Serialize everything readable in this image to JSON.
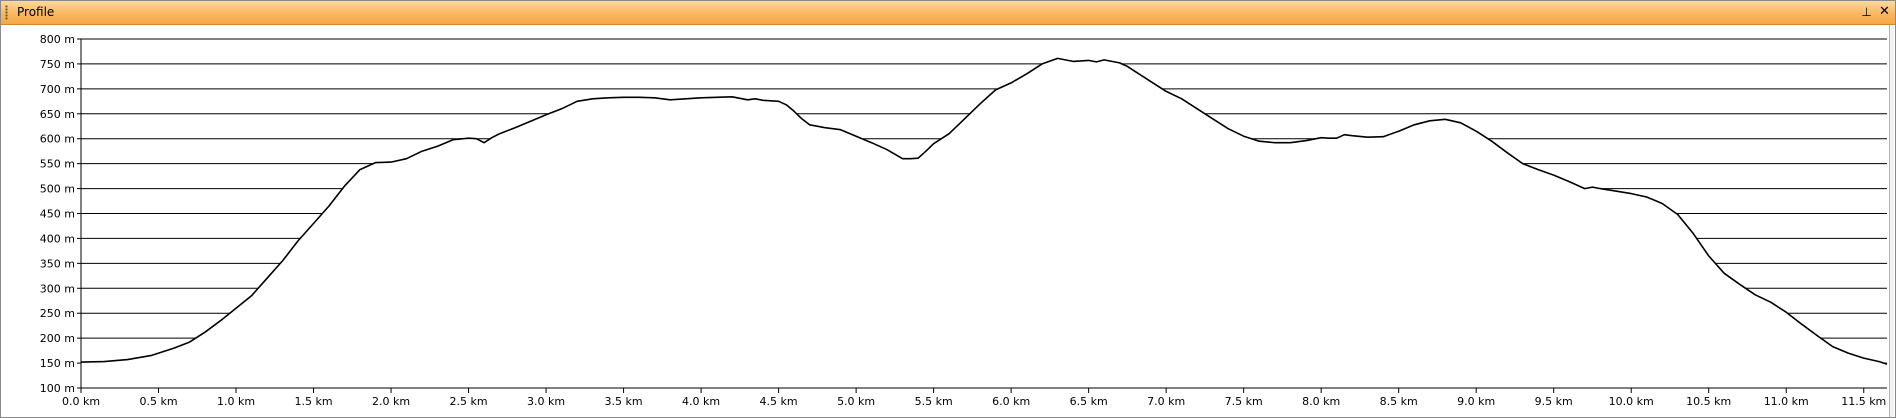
{
  "window": {
    "title": "Profile",
    "pin_icon": "pin-icon",
    "close_icon": "close-icon",
    "pin_glyph": "⊥",
    "close_glyph": "✕",
    "title_bar_color": "#f9b760"
  },
  "chart_data": {
    "type": "area",
    "title": "",
    "xlabel": "",
    "ylabel": "",
    "ylim": [
      100,
      800
    ],
    "xlim": [
      0,
      11.65
    ],
    "grid": "horizontal",
    "line_color": "#000000",
    "y_ticks": [
      {
        "value": 100,
        "label": "100 m"
      },
      {
        "value": 150,
        "label": "150 m"
      },
      {
        "value": 200,
        "label": "200 m"
      },
      {
        "value": 250,
        "label": "250 m"
      },
      {
        "value": 300,
        "label": "300 m"
      },
      {
        "value": 350,
        "label": "350 m"
      },
      {
        "value": 400,
        "label": "400 m"
      },
      {
        "value": 450,
        "label": "450 m"
      },
      {
        "value": 500,
        "label": "500 m"
      },
      {
        "value": 550,
        "label": "550 m"
      },
      {
        "value": 600,
        "label": "600 m"
      },
      {
        "value": 650,
        "label": "650 m"
      },
      {
        "value": 700,
        "label": "700 m"
      },
      {
        "value": 750,
        "label": "750 m"
      },
      {
        "value": 800,
        "label": "800 m"
      }
    ],
    "x_ticks": [
      {
        "value": 0.0,
        "label": "0.0 km"
      },
      {
        "value": 0.5,
        "label": "0.5 km"
      },
      {
        "value": 1.0,
        "label": "1.0 km"
      },
      {
        "value": 1.5,
        "label": "1.5 km"
      },
      {
        "value": 2.0,
        "label": "2.0 km"
      },
      {
        "value": 2.5,
        "label": "2.5 km"
      },
      {
        "value": 3.0,
        "label": "3.0 km"
      },
      {
        "value": 3.5,
        "label": "3.5 km"
      },
      {
        "value": 4.0,
        "label": "4.0 km"
      },
      {
        "value": 4.5,
        "label": "4.5 km"
      },
      {
        "value": 5.0,
        "label": "5.0 km"
      },
      {
        "value": 5.5,
        "label": "5.5 km"
      },
      {
        "value": 6.0,
        "label": "6.0 km"
      },
      {
        "value": 6.5,
        "label": "6.5 km"
      },
      {
        "value": 7.0,
        "label": "7.0 km"
      },
      {
        "value": 7.5,
        "label": "7.5 km"
      },
      {
        "value": 8.0,
        "label": "8.0 km"
      },
      {
        "value": 8.5,
        "label": "8.5 km"
      },
      {
        "value": 9.0,
        "label": "9.0 km"
      },
      {
        "value": 9.5,
        "label": "9.5 km"
      },
      {
        "value": 10.0,
        "label": "10.0 km"
      },
      {
        "value": 10.5,
        "label": "10.5 km"
      },
      {
        "value": 11.0,
        "label": "11.0 km"
      },
      {
        "value": 11.5,
        "label": "11.5 km"
      }
    ],
    "series": [
      {
        "x": [
          0.0,
          0.15,
          0.3,
          0.45,
          0.55,
          0.6,
          0.7,
          0.8,
          0.9,
          1.0,
          1.1,
          1.2,
          1.3,
          1.4,
          1.5,
          1.6,
          1.7,
          1.8,
          1.9,
          2.0,
          2.1,
          2.2,
          2.3,
          2.4,
          2.5,
          2.55,
          2.6,
          2.65,
          2.7,
          2.8,
          2.9,
          3.0,
          3.1,
          3.2,
          3.3,
          3.4,
          3.5,
          3.6,
          3.7,
          3.8,
          3.9,
          4.0,
          4.1,
          4.2,
          4.3,
          4.35,
          4.4,
          4.5,
          4.55,
          4.6,
          4.65,
          4.7,
          4.8,
          4.9,
          5.0,
          5.1,
          5.2,
          5.3,
          5.35,
          5.4,
          5.45,
          5.5,
          5.6,
          5.7,
          5.8,
          5.9,
          6.0,
          6.1,
          6.2,
          6.3,
          6.4,
          6.5,
          6.55,
          6.6,
          6.65,
          6.7,
          6.75,
          6.8,
          6.9,
          7.0,
          7.1,
          7.2,
          7.3,
          7.4,
          7.5,
          7.6,
          7.7,
          7.8,
          7.9,
          8.0,
          8.05,
          8.1,
          8.15,
          8.2,
          8.3,
          8.4,
          8.5,
          8.6,
          8.7,
          8.8,
          8.9,
          9.0,
          9.1,
          9.2,
          9.3,
          9.4,
          9.5,
          9.6,
          9.7,
          9.75,
          9.8,
          9.9,
          10.0,
          10.1,
          10.2,
          10.3,
          10.4,
          10.5,
          10.6,
          10.7,
          10.8,
          10.9,
          11.0,
          11.1,
          11.2,
          11.3,
          11.4,
          11.5,
          11.6,
          11.65
        ],
        "y": [
          152,
          153,
          157,
          165,
          175,
          180,
          192,
          212,
          235,
          260,
          285,
          320,
          355,
          395,
          430,
          465,
          505,
          538,
          552,
          553,
          560,
          575,
          585,
          598,
          601,
          600,
          592,
          602,
          610,
          622,
          635,
          648,
          660,
          675,
          680,
          682,
          683,
          683,
          682,
          678,
          680,
          682,
          683,
          684,
          678,
          680,
          677,
          675,
          668,
          655,
          640,
          628,
          622,
          618,
          605,
          592,
          578,
          560,
          560,
          561,
          575,
          590,
          610,
          640,
          670,
          698,
          712,
          730,
          750,
          761,
          755,
          757,
          754,
          758,
          755,
          752,
          745,
          735,
          715,
          695,
          680,
          660,
          640,
          620,
          605,
          595,
          592,
          592,
          596,
          602,
          601,
          601,
          608,
          606,
          603,
          604,
          615,
          628,
          636,
          639,
          632,
          615,
          595,
          572,
          550,
          538,
          527,
          514,
          500,
          503,
          500,
          495,
          490,
          483,
          470,
          448,
          410,
          365,
          330,
          308,
          287,
          272,
          252,
          228,
          205,
          183,
          170,
          160,
          153,
          148
        ]
      }
    ]
  }
}
